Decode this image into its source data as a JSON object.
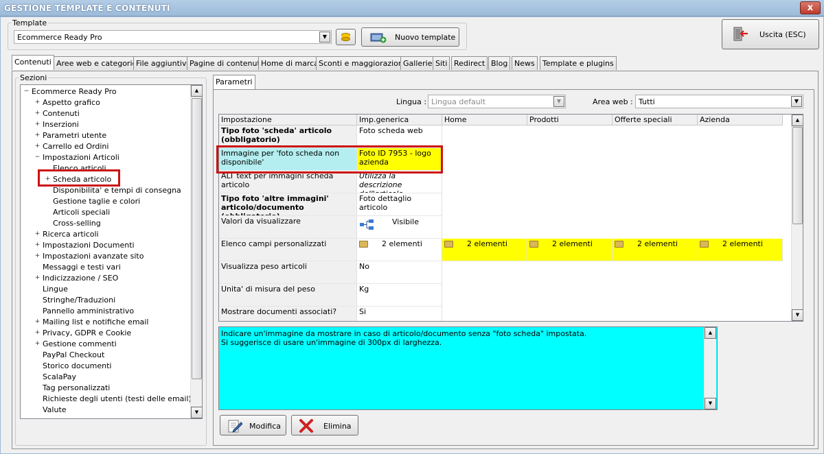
{
  "window": {
    "title": "GESTIONE TEMPLATE E CONTENUTI",
    "close": "x"
  },
  "template_group": {
    "legend": "Template",
    "selected": "Ecommerce Ready Pro",
    "new_button": "Nuovo template"
  },
  "exit_button": "Uscita (ESC)",
  "tabs": [
    "Contenuti",
    "Aree web e categorie",
    "File aggiuntivi",
    "Pagine di contenuti",
    "Home di marca",
    "Sconti e maggiorazioni",
    "Gallerie",
    "Siti",
    "Redirect",
    "Blog",
    "News",
    "Template e plugins"
  ],
  "sections": {
    "legend": "Sezioni",
    "tree": [
      {
        "label": "Ecommerce Ready Pro",
        "level": 0,
        "exp": "−"
      },
      {
        "label": "Aspetto grafico",
        "level": 1,
        "exp": "+"
      },
      {
        "label": "Contenuti",
        "level": 1,
        "exp": "+"
      },
      {
        "label": "Inserzioni",
        "level": 1,
        "exp": "+"
      },
      {
        "label": "Parametri utente",
        "level": 1,
        "exp": "+"
      },
      {
        "label": "Carrello ed Ordini",
        "level": 1,
        "exp": "+"
      },
      {
        "label": "Impostazioni Articoli",
        "level": 1,
        "exp": "−"
      },
      {
        "label": "Elenco articoli",
        "level": 2,
        "exp": ""
      },
      {
        "label": "Scheda articolo",
        "level": 2,
        "exp": "+"
      },
      {
        "label": "Disponibilita' e tempi di consegna",
        "level": 2,
        "exp": ""
      },
      {
        "label": "Gestione taglie e colori",
        "level": 2,
        "exp": ""
      },
      {
        "label": "Articoli speciali",
        "level": 2,
        "exp": ""
      },
      {
        "label": "Cross-selling",
        "level": 2,
        "exp": ""
      },
      {
        "label": "Ricerca articoli",
        "level": 1,
        "exp": "+"
      },
      {
        "label": "Impostazioni Documenti",
        "level": 1,
        "exp": "+"
      },
      {
        "label": "Impostazioni avanzate sito",
        "level": 1,
        "exp": "+"
      },
      {
        "label": "Messaggi e testi vari",
        "level": 1,
        "exp": ""
      },
      {
        "label": "Indicizzazione / SEO",
        "level": 1,
        "exp": "+"
      },
      {
        "label": "Lingue",
        "level": 1,
        "exp": ""
      },
      {
        "label": "Stringhe/Traduzioni",
        "level": 1,
        "exp": ""
      },
      {
        "label": "Pannello amministrativo",
        "level": 1,
        "exp": ""
      },
      {
        "label": "Mailing list e notifiche email",
        "level": 1,
        "exp": "+"
      },
      {
        "label": "Privacy, GDPR e Cookie",
        "level": 1,
        "exp": "+"
      },
      {
        "label": "Gestione commenti",
        "level": 1,
        "exp": "+"
      },
      {
        "label": "PayPal Checkout",
        "level": 1,
        "exp": ""
      },
      {
        "label": "Storico documenti",
        "level": 1,
        "exp": ""
      },
      {
        "label": "ScalaPay",
        "level": 1,
        "exp": ""
      },
      {
        "label": "Tag personalizzati",
        "level": 1,
        "exp": ""
      },
      {
        "label": "Richieste degli utenti (testi delle email)",
        "level": 1,
        "exp": ""
      },
      {
        "label": "Valute",
        "level": 1,
        "exp": ""
      }
    ]
  },
  "params": {
    "tab": "Parametri",
    "lingua_label": "Lingua :",
    "lingua_value": "Lingua default",
    "area_label": "Area web :",
    "area_value": "Tutti",
    "columns": [
      "Impostazione",
      "Imp.generica",
      "Home",
      "Prodotti",
      "Offerte speciali",
      "Azienda"
    ],
    "rows": [
      {
        "key": "Tipo foto 'scheda' articolo (obbligatorio)",
        "bold": true,
        "generic": "Foto scheda web"
      },
      {
        "key": "Immagine per 'foto scheda non disponibile'",
        "bold": false,
        "generic": "Foto ID 7953 - logo azienda"
      },
      {
        "key": "ALT text per immagini scheda articolo",
        "bold": false,
        "generic": "Utilizza la descrizione dell'articolo"
      },
      {
        "key": "Tipo foto 'altre immagini' articolo/documento (obbligatorio)",
        "bold": true,
        "generic": "Foto dettaglio articolo"
      },
      {
        "key": "Valori da visualizzare",
        "bold": false,
        "generic": "Visibile"
      },
      {
        "key": "Elenco campi personalizzati",
        "bold": false,
        "generic": "2 elementi",
        "home": "2 elementi",
        "prodotti": "2 elementi",
        "offerte": "2 elementi",
        "azienda": "2 elementi"
      },
      {
        "key": "Visualizza peso articoli",
        "bold": false,
        "generic": "No"
      },
      {
        "key": "Unita' di misura del peso",
        "bold": false,
        "generic": "Kg"
      },
      {
        "key": "Mostrare documenti associati?",
        "bold": false,
        "generic": "Si"
      }
    ],
    "description_line1": "Indicare un'immagine da mostrare in caso di articolo/documento senza \"foto scheda\" impostata.",
    "description_line2": "Si suggerisce di usare un'immagine di 300px di larghezza.",
    "modify_button": "Modifica",
    "delete_button": "Elimina"
  },
  "colors": {
    "highlight": "#ffff00",
    "description_bg": "#00ffff",
    "selection_border": "#cc1111"
  }
}
